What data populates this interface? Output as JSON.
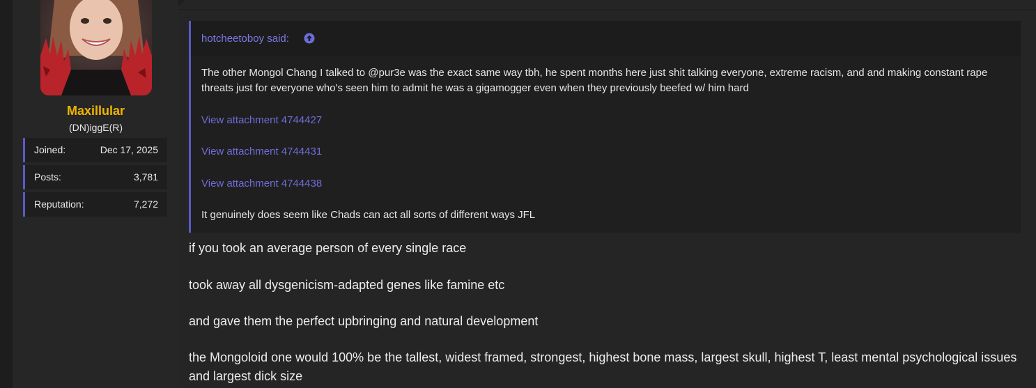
{
  "user": {
    "name": "Maxillular",
    "title": "(DN)iggE(R)",
    "stats": [
      {
        "label": "Joined:",
        "value": "Dec 17, 2025"
      },
      {
        "label": "Posts:",
        "value": "3,781"
      },
      {
        "label": "Reputation:",
        "value": "7,272"
      }
    ]
  },
  "quote": {
    "author": "hotcheetoboy said:",
    "text": "The other Mongol Chang I talked to @pur3e was the exact same way tbh, he spent months here just shit talking everyone, extreme racism, and and making constant rape threats just for everyone who's seen him to admit he was a gigamogger even when they previously beefed w/ him hard",
    "attachments": [
      "View attachment 4744427",
      "View attachment 4744431",
      "View attachment 4744438"
    ],
    "closing": "It genuinely does seem like Chads can act all sorts of different ways JFL"
  },
  "post": {
    "paragraphs": [
      "if you took an average person of every single race",
      "took away all dysgenicism-adapted genes like famine etc",
      "and gave them the perfect upbringing and natural development",
      "the Mongoloid one would 100% be the tallest, widest framed, strongest, highest bone mass, largest skull, highest T, least mental psychological issues and largest dick size"
    ]
  },
  "colors": {
    "accent": "#5b59c7",
    "link": "#6e6cd8",
    "username": "#f0b400",
    "background": "#252525"
  },
  "icons": {
    "quote_jump": "arrow-circle-up-icon"
  }
}
